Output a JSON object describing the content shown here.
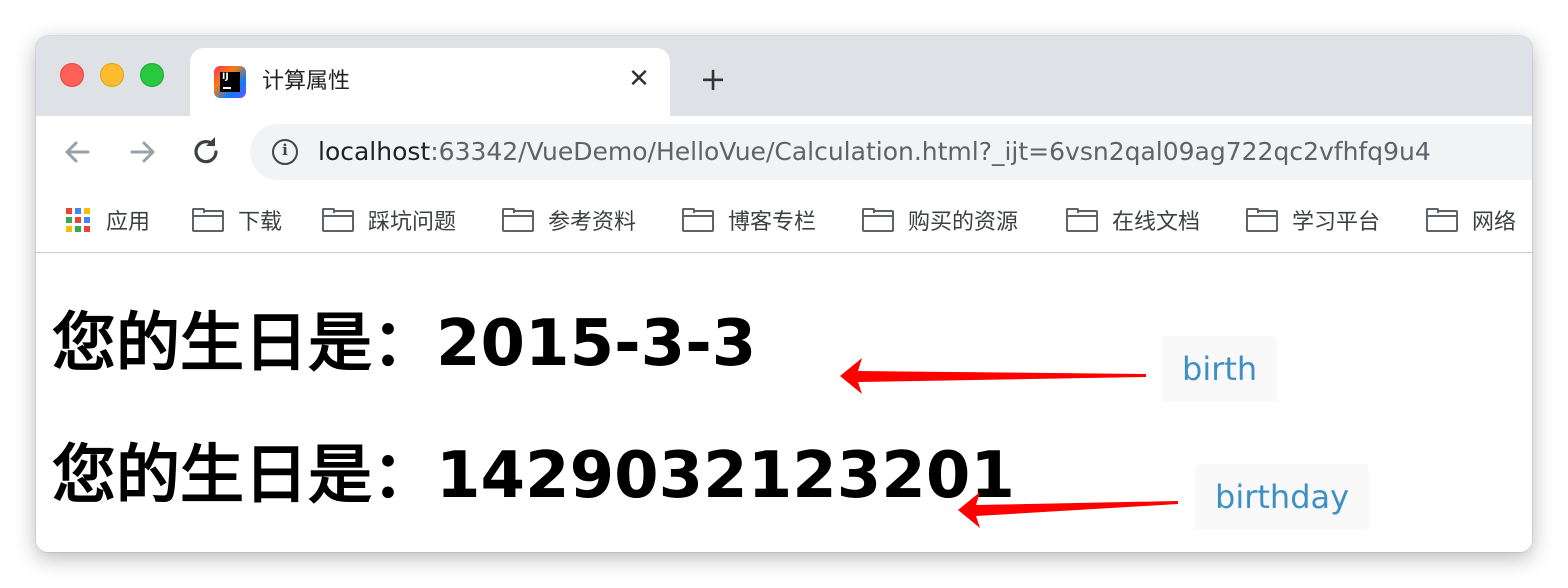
{
  "tab": {
    "title": "计算属性"
  },
  "toolbar": {
    "url_host": "localhost",
    "url_rest": ":63342/VueDemo/HelloVue/Calculation.html?_ijt=6vsn2qal09ag722qc2vfhfq9u4"
  },
  "bookmarks": [
    {
      "label": "应用",
      "icon": "apps-grid-icon"
    },
    {
      "label": "下载",
      "icon": "folder-icon"
    },
    {
      "label": "踩坑问题",
      "icon": "folder-icon"
    },
    {
      "label": "参考资料",
      "icon": "folder-icon"
    },
    {
      "label": "博客专栏",
      "icon": "folder-icon"
    },
    {
      "label": "购买的资源",
      "icon": "folder-icon"
    },
    {
      "label": "在线文档",
      "icon": "folder-icon"
    },
    {
      "label": "学习平台",
      "icon": "folder-icon"
    },
    {
      "label": "网络",
      "icon": "folder-icon"
    }
  ],
  "content": {
    "line1": "您的生日是：2015-3-3",
    "line2": "您的生日是：1429032123201",
    "annotation1": "birth",
    "annotation2": "birthday"
  },
  "colors": {
    "annotation_text": "#3d8fc4",
    "arrow": "#ff0000"
  }
}
